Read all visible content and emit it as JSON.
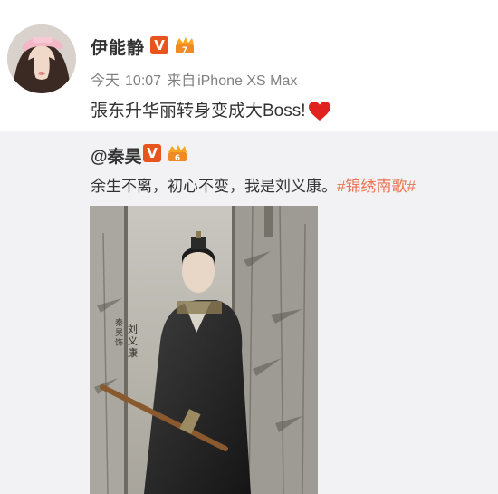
{
  "post": {
    "username": "伊能静",
    "verified_badge": "V",
    "meta": {
      "date": "今天",
      "time": "10:07",
      "source_prefix": "来自",
      "device": "iPhone XS Max"
    },
    "text": "張东升华丽转身变成大Boss!",
    "emoji": "red-heart"
  },
  "repost": {
    "username": "@秦昊",
    "verified_badge": "V",
    "text": "余生不离，初心不变，我是刘义康。",
    "hashtag": "#锦绣南歌#",
    "image": {
      "description_icon": "drama-poster-image",
      "vertical_caption": "刘义康",
      "actor_caption": "秦昊 饰"
    }
  },
  "colors": {
    "accent": "#eb7350",
    "badge": "#e8541e",
    "repost_bg": "#f2f2f5",
    "meta_text": "#808080"
  }
}
